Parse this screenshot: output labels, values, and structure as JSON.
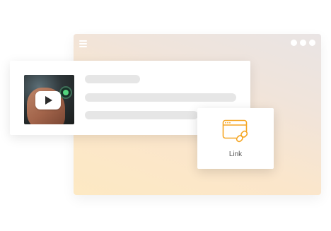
{
  "link_card": {
    "label": "Link",
    "icon": "browser-link-icon",
    "accent_color": "#f5a623"
  },
  "background_window": {
    "gradient_colors": [
      "#fde9c3",
      "#e9e4e4"
    ],
    "menu_icon": "hamburger-menu-icon",
    "window_controls": "three-dots-icon"
  },
  "video_card": {
    "thumbnail_icon": "play-icon"
  }
}
